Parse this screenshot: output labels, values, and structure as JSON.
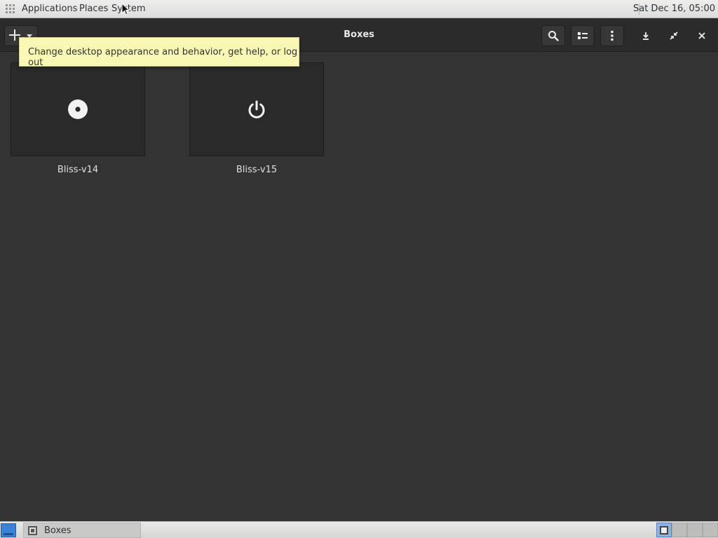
{
  "top_panel": {
    "menus": [
      "Applications",
      "Places",
      "System"
    ],
    "clock": "Sat Dec 16, 05:00"
  },
  "headerbar": {
    "title": "Boxes",
    "icons": [
      "plus-icon",
      "chevron-down-icon",
      "search-icon",
      "selection-mode-icon",
      "menu-dots-icon",
      "minimize-icon",
      "restore-icon",
      "close-icon"
    ]
  },
  "tooltip": {
    "text": "Change desktop appearance and behavior, get help, or log out"
  },
  "boxes": [
    {
      "name": "Bliss-v14",
      "icon": "disc-icon"
    },
    {
      "name": "Bliss-v15",
      "icon": "power-icon"
    }
  ],
  "bottom_panel": {
    "task_label": "Boxes",
    "workspaces": 4,
    "active_workspace": 1
  },
  "colors": {
    "window_bg": "#333333",
    "headerbar_bg": "#2b2b2b",
    "tooltip_bg": "#f8f8b4",
    "panel_bg": "#e2e2e0",
    "accent": "#3a82d6"
  }
}
